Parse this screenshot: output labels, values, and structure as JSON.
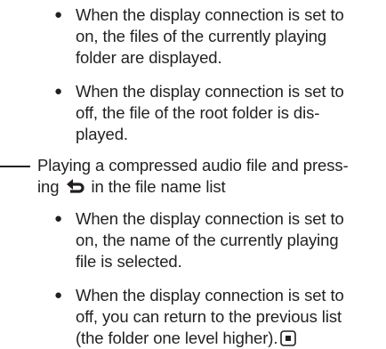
{
  "bullets": {
    "b1": [
      "When the display connection is set to",
      "on, the files of the currently playing",
      "folder are displayed."
    ],
    "b2": [
      "When the display connection is set to",
      "off, the file of the root folder is dis-",
      "played."
    ],
    "b3": [
      "When the display connection is set to",
      "on, the name of the currently playing",
      "file is selected."
    ],
    "b4": [
      "When the display connection is set to",
      "off, you can return to the previous list",
      "(the folder one level higher)."
    ]
  },
  "dash_item": {
    "line1": "Playing a compressed audio file and press-",
    "line2_pre": "ing",
    "line2_post": "in the file name list"
  },
  "icons": {
    "back": "return-arrow-icon",
    "end_mark": "stop-square-icon"
  },
  "colors": {
    "text": "#231f20"
  }
}
